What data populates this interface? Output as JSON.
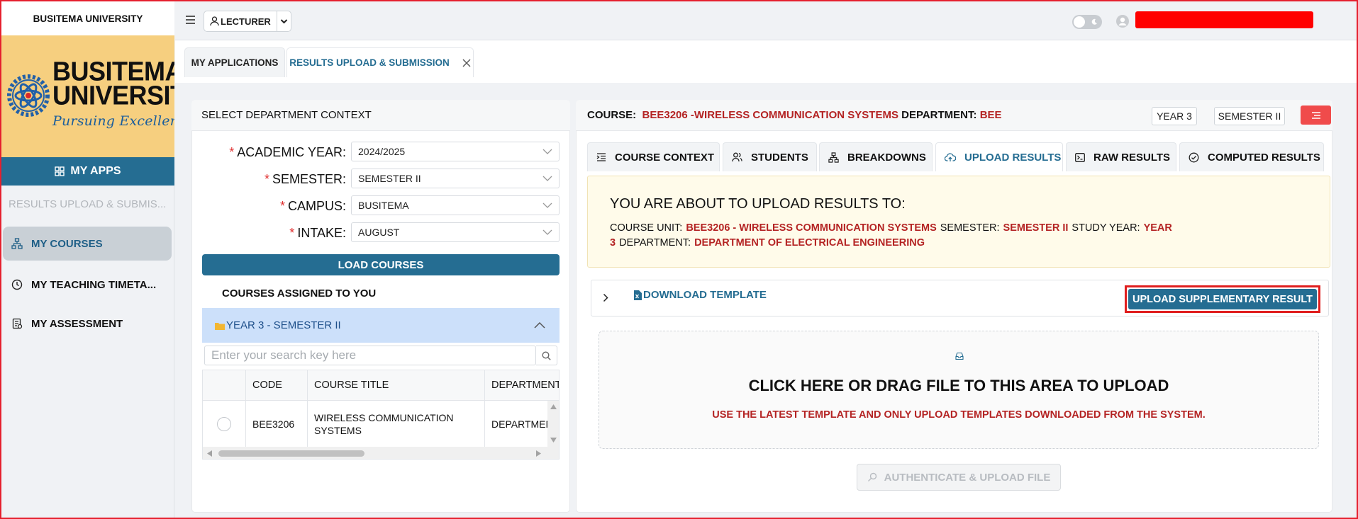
{
  "sidebar": {
    "title": "BUSITEMA UNIVERSITY",
    "logo": {
      "line1": "BUSITEMA",
      "line2": "UNIVERSITY",
      "motto": "Pursuing Excellence"
    },
    "my_apps": "MY APPS",
    "breadcrumb": "RESULTS UPLOAD & SUBMIS...",
    "nav": [
      {
        "label": "MY COURSES",
        "icon": "hierarchy-icon",
        "active": true
      },
      {
        "label": "MY TEACHING TIMETA...",
        "icon": "clock-icon"
      },
      {
        "label": "MY ASSESSMENT",
        "icon": "assessment-icon"
      }
    ]
  },
  "topbar": {
    "role": "LECTURER",
    "theme_toggle": "off"
  },
  "page_tabs": [
    {
      "label": "MY APPLICATIONS"
    },
    {
      "label": "RESULTS UPLOAD & SUBMISSION",
      "active": true
    }
  ],
  "left_panel": {
    "title": "SELECT DEPARTMENT CONTEXT",
    "fields": [
      {
        "label": "ACADEMIC YEAR:",
        "value": "2024/2025"
      },
      {
        "label": "SEMESTER:",
        "value": "SEMESTER II"
      },
      {
        "label": "CAMPUS:",
        "value": "BUSITEMA"
      },
      {
        "label": "INTAKE:",
        "value": "AUGUST"
      }
    ],
    "load_button": "LOAD COURSES",
    "assigned_title": "COURSES ASSIGNED TO YOU",
    "group": "YEAR 3 - SEMESTER II",
    "search_placeholder": "Enter your search key here",
    "table": {
      "headers": [
        "CODE",
        "COURSE TITLE",
        "DEPARTMENT"
      ],
      "rows": [
        {
          "code": "BEE3206",
          "title": "WIRELESS COMMUNICATION SYSTEMS",
          "department": "DEPARTMEN"
        }
      ]
    }
  },
  "right_panel": {
    "course_label": "COURSE:",
    "course_value": "BEE3206 -WIRELESS COMMUNICATION SYSTEMS",
    "dept_label": "DEPARTMENT:",
    "dept_value": "BEE",
    "year_chip": "YEAR 3",
    "semester_chip": "SEMESTER II",
    "tabs": [
      {
        "label": "COURSE CONTEXT",
        "icon": "list-indent-icon"
      },
      {
        "label": "STUDENTS",
        "icon": "users-icon"
      },
      {
        "label": "BREAKDOWNS",
        "icon": "hierarchy-icon"
      },
      {
        "label": "UPLOAD RESULTS",
        "icon": "cloud-upload-icon",
        "active": true
      },
      {
        "label": "RAW RESULTS",
        "icon": "terminal-icon"
      },
      {
        "label": "COMPUTED RESULTS",
        "icon": "check-circle-icon"
      }
    ],
    "notice": {
      "heading": "YOU ARE ABOUT TO UPLOAD RESULTS TO:",
      "course_unit_label": "COURSE UNIT:",
      "course_unit_value": "BEE3206 - WIRELESS COMMUNICATION SYSTEMS",
      "semester_label": "SEMESTER:",
      "semester_value": "SEMESTER II",
      "study_year_label": "STUDY YEAR:",
      "study_year_value_a": "YEAR",
      "study_year_value_b": "3",
      "department_label": "DEPARTMENT:",
      "department_value": "DEPARTMENT OF ELECTRICAL ENGINEERING"
    },
    "download_template": "DOWNLOAD TEMPLATE",
    "upload_supplementary": "UPLOAD SUPPLEMENTARY RESULT",
    "dropzone": {
      "title": "CLICK HERE OR DRAG FILE TO THIS AREA TO UPLOAD",
      "hint": "USE THE LATEST TEMPLATE AND ONLY UPLOAD TEMPLATES DOWNLOADED FROM THE SYSTEM."
    },
    "auth_button": "AUTHENTICATE & UPLOAD FILE"
  },
  "colors": {
    "primary": "#256d92",
    "accent_red": "#b42323",
    "danger": "#f04b4b",
    "logo_bg": "#f6cf7f",
    "redaction": "#ff0000"
  }
}
